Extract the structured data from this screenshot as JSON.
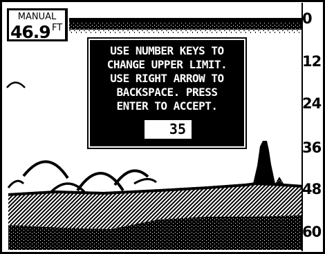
{
  "range_mode": {
    "label": "MANUAL",
    "value": "46.9",
    "unit": "FT"
  },
  "depth_scale": [
    "0",
    "12",
    "24",
    "36",
    "48",
    "60"
  ],
  "dialog": {
    "message": "USE NUMBER KEYS TO\nCHANGE UPPER LIMIT.\nUSE RIGHT ARROW TO\nBACKSPACE. PRESS\nENTER TO ACCEPT.",
    "entry_value": "35"
  },
  "colors": {
    "foreground": "#000000",
    "background": "#ffffff"
  }
}
